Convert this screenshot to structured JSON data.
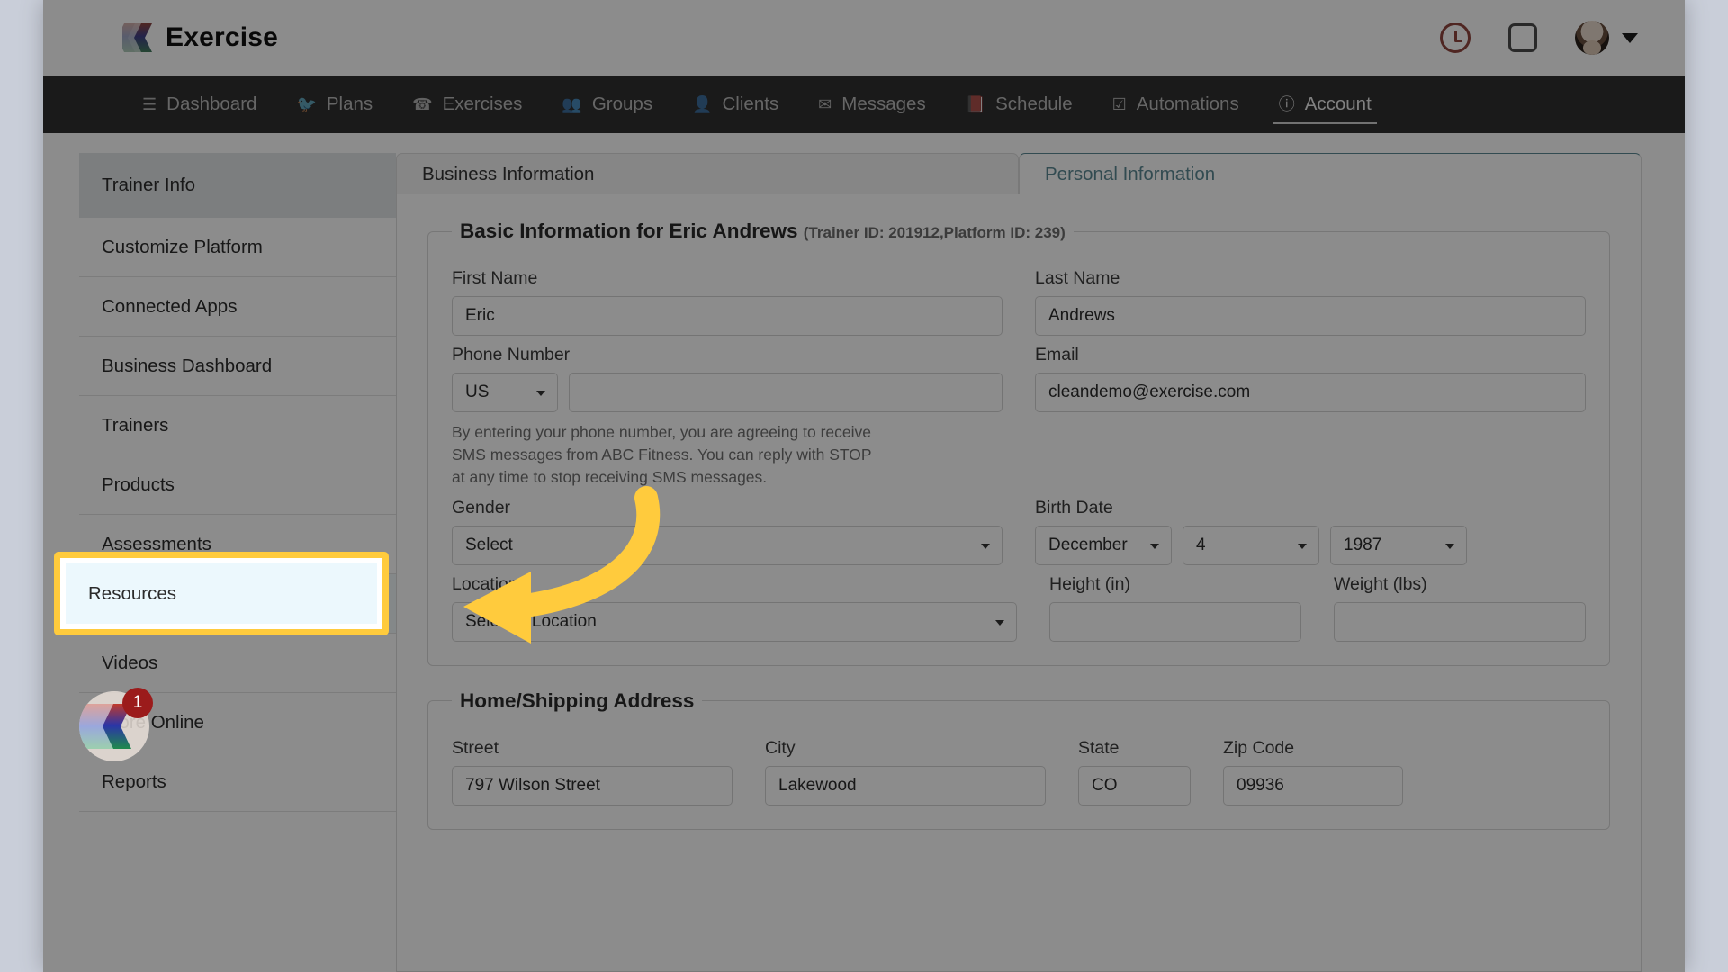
{
  "header": {
    "brand": "Exercise",
    "icons": [
      {
        "name": "clock-icon",
        "glyph": "clock"
      },
      {
        "name": "square-icon",
        "glyph": "square"
      },
      {
        "name": "avatar",
        "glyph": "avatar"
      },
      {
        "name": "chevron-down-icon",
        "glyph": "chevron"
      }
    ]
  },
  "nav": {
    "items": [
      {
        "label": "Dashboard",
        "icon": "list-icon",
        "glyph": "☰",
        "active": false
      },
      {
        "label": "Plans",
        "icon": "bird-icon",
        "glyph": "🐦",
        "active": false
      },
      {
        "label": "Exercises",
        "icon": "phone-icon",
        "glyph": "☎",
        "active": false
      },
      {
        "label": "Groups",
        "icon": "people-icon",
        "glyph": "👥",
        "active": false
      },
      {
        "label": "Clients",
        "icon": "person-icon",
        "glyph": "👤",
        "active": false
      },
      {
        "label": "Messages",
        "icon": "envelope-icon",
        "glyph": "✉",
        "active": false
      },
      {
        "label": "Schedule",
        "icon": "book-icon",
        "glyph": "📕",
        "active": false
      },
      {
        "label": "Automations",
        "icon": "check-square-icon",
        "glyph": "☑",
        "active": false
      },
      {
        "label": "Account",
        "icon": "account-circle-icon",
        "glyph": "ⓘ",
        "active": true
      }
    ]
  },
  "sidebar": {
    "items": [
      {
        "label": "Trainer Info",
        "selected": true
      },
      {
        "label": "Customize Platform",
        "selected": false
      },
      {
        "label": "Connected Apps",
        "selected": false
      },
      {
        "label": "Business Dashboard",
        "selected": false
      },
      {
        "label": "Trainers",
        "selected": false
      },
      {
        "label": "Products",
        "selected": false
      },
      {
        "label": "Assessments",
        "selected": false
      },
      {
        "label": "Resources",
        "selected": false,
        "highlighted": true
      },
      {
        "label": "Videos",
        "selected": false
      },
      {
        "label": "Store Online",
        "selected": false
      },
      {
        "label": "Reports",
        "selected": false
      }
    ]
  },
  "tabs": [
    {
      "label": "Business Information",
      "active": false
    },
    {
      "label": "Personal Information",
      "active": true
    }
  ],
  "basic_info": {
    "legend_main": "Basic Information for Eric Andrews",
    "legend_sub": "(Trainer ID: 201912,Platform ID: 239)",
    "first_name": {
      "label": "First Name",
      "value": "Eric"
    },
    "last_name": {
      "label": "Last Name",
      "value": "Andrews"
    },
    "phone": {
      "label": "Phone Number",
      "country": "US",
      "value": ""
    },
    "email": {
      "label": "Email",
      "value": "cleandemo@exercise.com"
    },
    "sms_disclaimer": "By entering your phone number, you are agreeing to receive SMS messages from ABC Fitness. You can reply with STOP at any time to stop receiving SMS messages.",
    "gender": {
      "label": "Gender",
      "value": "Select"
    },
    "birth_date": {
      "label": "Birth Date",
      "month": "December",
      "day": "4",
      "year": "1987"
    },
    "location": {
      "label": "Location",
      "value": "Select a Location"
    },
    "height": {
      "label": "Height (in)",
      "value": ""
    },
    "weight": {
      "label": "Weight (lbs)",
      "value": ""
    }
  },
  "address": {
    "legend": "Home/Shipping Address",
    "street": {
      "label": "Street",
      "value": "797 Wilson Street"
    },
    "city": {
      "label": "City",
      "value": "Lakewood"
    },
    "state": {
      "label": "State",
      "value": "CO"
    },
    "zip": {
      "label": "Zip Code",
      "value": "09936"
    }
  },
  "callout": {
    "target_label": "Resources",
    "border_color": "#ffcb3d",
    "arrow_color": "#ffcb3d"
  },
  "launcher": {
    "badge_count": "1",
    "name": "app-launcher"
  },
  "colors": {
    "nav_bg": "#2f2f2f",
    "active_tab_text": "#3d8fa3",
    "selected_sidebar": "#dfe5e8",
    "highlight_bg": "#ecf8fd",
    "badge_bg": "#9b1b1b"
  }
}
